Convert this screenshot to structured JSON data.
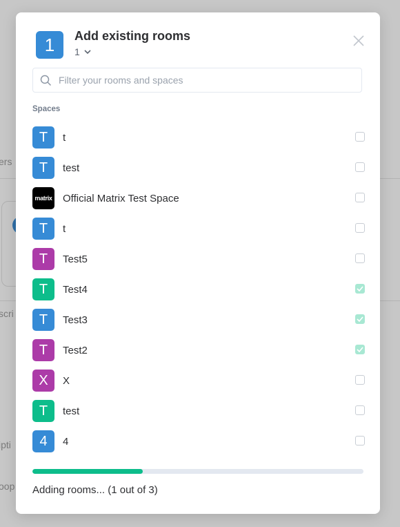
{
  "background": {
    "fragments": [
      "ers",
      "scri",
      "ipti",
      "oop"
    ]
  },
  "dialog": {
    "avatar_letter": "1",
    "title": "Add existing rooms",
    "subtitle": "1",
    "search": {
      "placeholder": "Filter your rooms and spaces",
      "value": ""
    },
    "section_label": "Spaces",
    "rooms": [
      {
        "letter": "T",
        "name": "t",
        "color": "#368bd6",
        "checked": false
      },
      {
        "letter": "T",
        "name": "test",
        "color": "#368bd6",
        "checked": false
      },
      {
        "letter": "matrix",
        "name": "Official Matrix Test Space",
        "color": "#000000",
        "checked": false,
        "logo": true
      },
      {
        "letter": "T",
        "name": "t",
        "color": "#368bd6",
        "checked": false
      },
      {
        "letter": "T",
        "name": "Test5",
        "color": "#ac3ba8",
        "checked": false
      },
      {
        "letter": "T",
        "name": "Test4",
        "color": "#0dbd8b",
        "checked": true
      },
      {
        "letter": "T",
        "name": "Test3",
        "color": "#368bd6",
        "checked": true
      },
      {
        "letter": "T",
        "name": "Test2",
        "color": "#ac3ba8",
        "checked": true
      },
      {
        "letter": "X",
        "name": "X",
        "color": "#ac3ba8",
        "checked": false
      },
      {
        "letter": "T",
        "name": "test",
        "color": "#0dbd8b",
        "checked": false
      },
      {
        "letter": "4",
        "name": "4",
        "color": "#368bd6",
        "checked": false
      }
    ],
    "progress": {
      "done": 1,
      "total": 3,
      "fraction": 0.333
    },
    "status_text": "Adding rooms... (1 out of 3)"
  },
  "colors": {
    "accent": "#0dbd8b",
    "avatar_blue": "#368bd6",
    "avatar_purple": "#ac3ba8",
    "avatar_green": "#0dbd8b"
  }
}
